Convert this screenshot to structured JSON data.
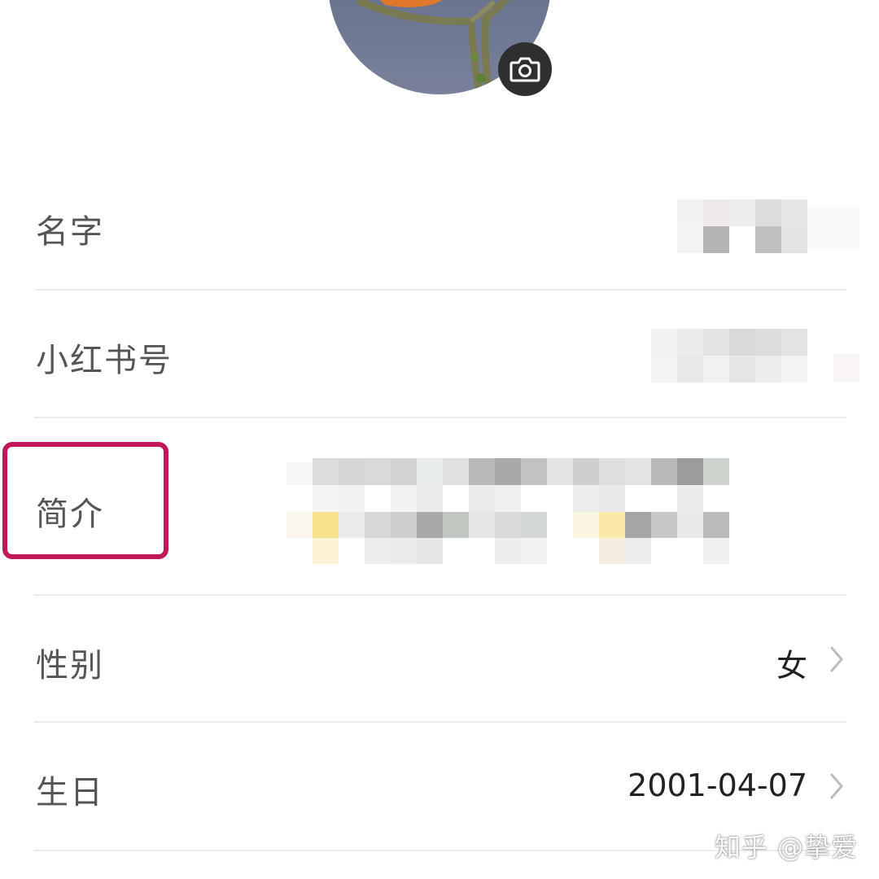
{
  "profile": {
    "avatar_label": "avatar",
    "camera_icon": "camera-icon"
  },
  "fields": [
    {
      "label": "名字",
      "value": ""
    },
    {
      "label": "小红书号",
      "value": ""
    },
    {
      "label": "简介",
      "value": ""
    },
    {
      "label": "性别",
      "value": "女"
    },
    {
      "label": "生日",
      "value": "2001-04-07"
    }
  ],
  "highlight": {
    "target": "简介",
    "color": "#c2185b"
  },
  "watermark": "知乎 @挚爱",
  "colors": {
    "label": "#555555",
    "value": "#222222",
    "divider": "#ececec",
    "chevron": "#bdbdbd"
  }
}
